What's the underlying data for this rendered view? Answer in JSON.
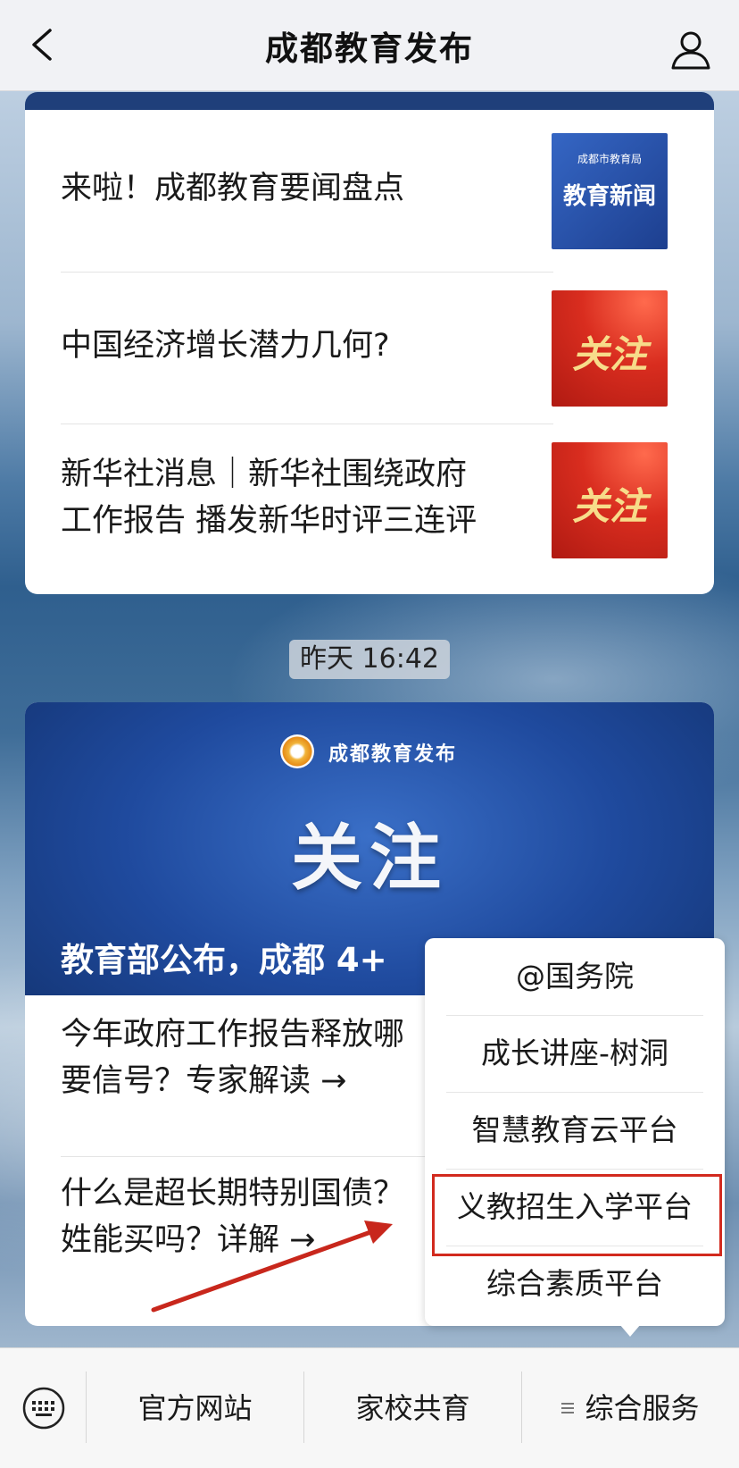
{
  "header": {
    "title": "成都教育发布"
  },
  "card1": {
    "items": [
      {
        "title": "来啦！成都教育要闻盘点",
        "thumb_small": "成都市教育局",
        "thumb_big": "教育新闻"
      },
      {
        "title": "中国经济增长潜力几何?",
        "thumb_text": "关注"
      },
      {
        "title_line1": "新华社消息｜新华社围绕政府",
        "title_line2": "工作报告 播发新华时评三连评",
        "thumb_text": "关注"
      }
    ]
  },
  "timestamp": "昨天 16:42",
  "card2": {
    "banner_brand": "成都教育发布",
    "banner_big": "关注",
    "banner_caption": "教育部公布，成都 4+",
    "items": [
      {
        "line1": "今年政府工作报告释放哪",
        "line2": "要信号？专家解读 →"
      },
      {
        "line1": "什么是超长期特别国债？",
        "line2": "姓能买吗？详解 →"
      }
    ]
  },
  "popup": {
    "items": [
      "@国务院",
      "成长讲座-树洞",
      "智慧教育云平台",
      "义教招生入学平台",
      "综合素质平台"
    ],
    "highlighted_index": 3
  },
  "tabbar": {
    "tabs": [
      "官方网站",
      "家校共育",
      "综合服务"
    ]
  },
  "colors": {
    "highlight": "#d22a1e",
    "nav_bg": "#f1f2f5"
  },
  "icons": [
    "back-arrow-icon",
    "user-icon",
    "keyboard-icon",
    "menu-icon"
  ]
}
